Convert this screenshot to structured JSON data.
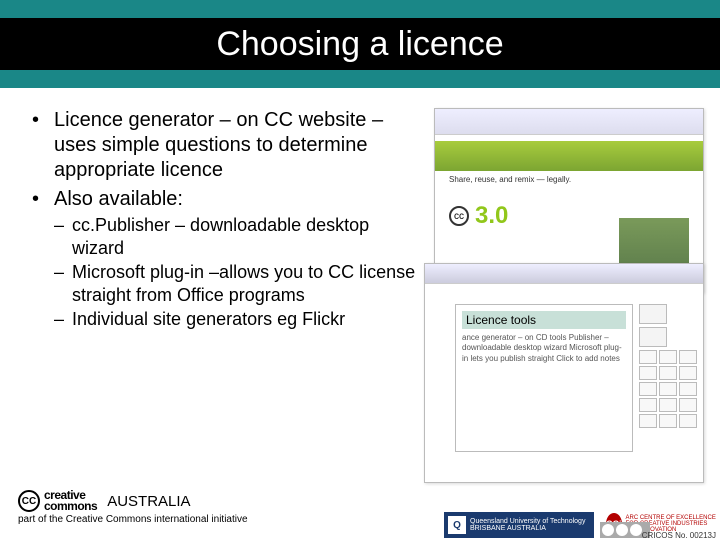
{
  "title": "Choosing a licence",
  "bullets": [
    "Licence generator – on CC website – uses simple questions to determine appropriate licence",
    "Also available:"
  ],
  "sub_bullets": [
    "cc.Publisher – downloadable desktop wizard",
    "Microsoft plug-in –allows you to CC license straight from Office programs",
    "Individual site generators eg Flickr"
  ],
  "screenshot1": {
    "headline": "Share, reuse, and remix — legally.",
    "version": "3.0"
  },
  "screenshot2": {
    "slide_heading": "Licence tools",
    "slide_body": "ance generator – on CD\ntools\nPublisher – downloadable desktop wizard\nMicrosoft plug-in\nlets you publish straight\n            Click to add notes"
  },
  "footer": {
    "cc_top": "creative",
    "cc_bottom": "commons",
    "australia": "AUSTRALIA",
    "tagline": "part of the Creative Commons international initiative",
    "qut": "Queensland University of Technology",
    "qut_sub": "BRISBANE AUSTRALIA",
    "cci": "ARC CENTRE OF EXCELLENCE FOR CREATIVE INDUSTRIES AND INNOVATION",
    "cricos": "CRICOS No. 00213J"
  }
}
